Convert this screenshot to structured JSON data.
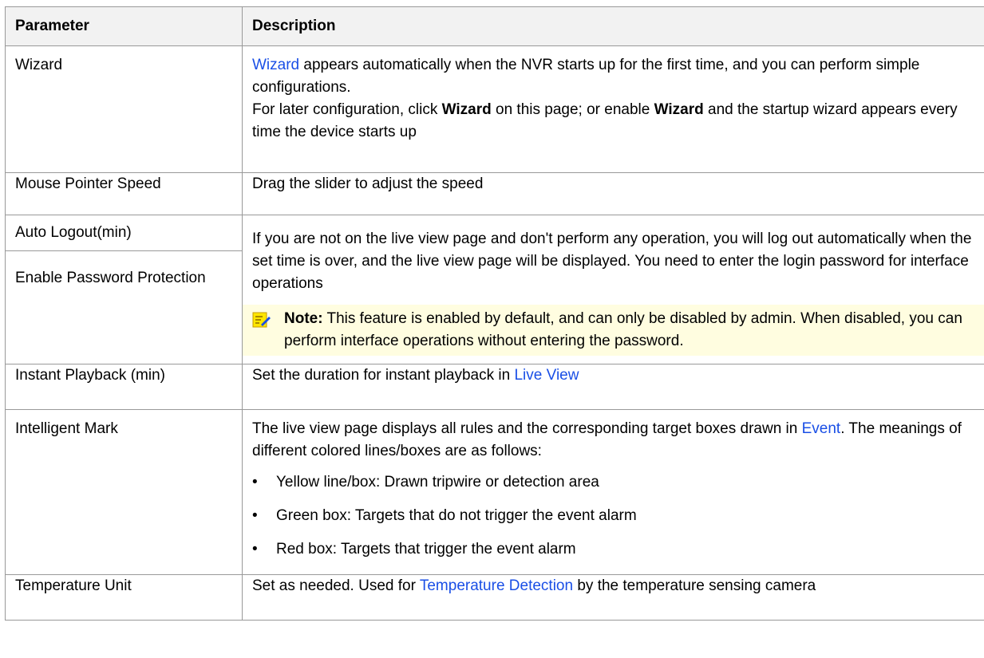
{
  "table": {
    "headers": [
      "Parameter",
      "Description"
    ],
    "wizard": {
      "param": "Wizard",
      "link": "Wizard",
      "text1": " appears automatically when the NVR starts up for the first time, and you can perform simple configurations.",
      "text2a": "For later configuration, click ",
      "bold1": "Wizard",
      "text2b": " on this page; or enable ",
      "bold2": "Wizard",
      "text2c": " and the startup wizard appears every time the device starts up"
    },
    "mouse": {
      "param": "Mouse Pointer Speed",
      "desc": "Drag the slider to adjust the speed"
    },
    "autologout": {
      "param1": "Auto Logout(min)",
      "param2": "Enable Password Protection",
      "desc": "If you are not on the live view page and don't perform any operation, you will log out automatically when the set time is over, and the live view page will be displayed. You need to enter the login password for interface operations",
      "note_label": "Note:",
      "note_text": " This feature is enabled by default, and can only be disabled by admin. When disabled, you can perform interface operations without entering the password."
    },
    "playback": {
      "param": "Instant Playback (min)",
      "desc": "Set the duration for instant playback in ",
      "link": "Live View"
    },
    "mark": {
      "param": "Intelligent Mark",
      "desc_a": "The live view page displays all rules and the corresponding target boxes drawn in ",
      "link": "Event",
      "desc_b": ". The meanings of different colored lines/boxes are as follows:",
      "bullets": [
        "Yellow line/box: Drawn tripwire or detection area",
        "Green box: Targets that do not trigger the event alarm",
        "Red box: Targets that trigger the event alarm"
      ]
    },
    "temp": {
      "param": "Temperature Unit",
      "desc_a": "Set as needed. Used for ",
      "link": "Temperature Detection",
      "desc_b": " by the temperature sensing camera"
    }
  },
  "colors": {
    "link": "#1a4fe6",
    "header_bg": "#f2f2f2",
    "note_bg": "#fffde0",
    "border": "#999999"
  },
  "icons": {
    "note": "note-pencil-icon"
  }
}
